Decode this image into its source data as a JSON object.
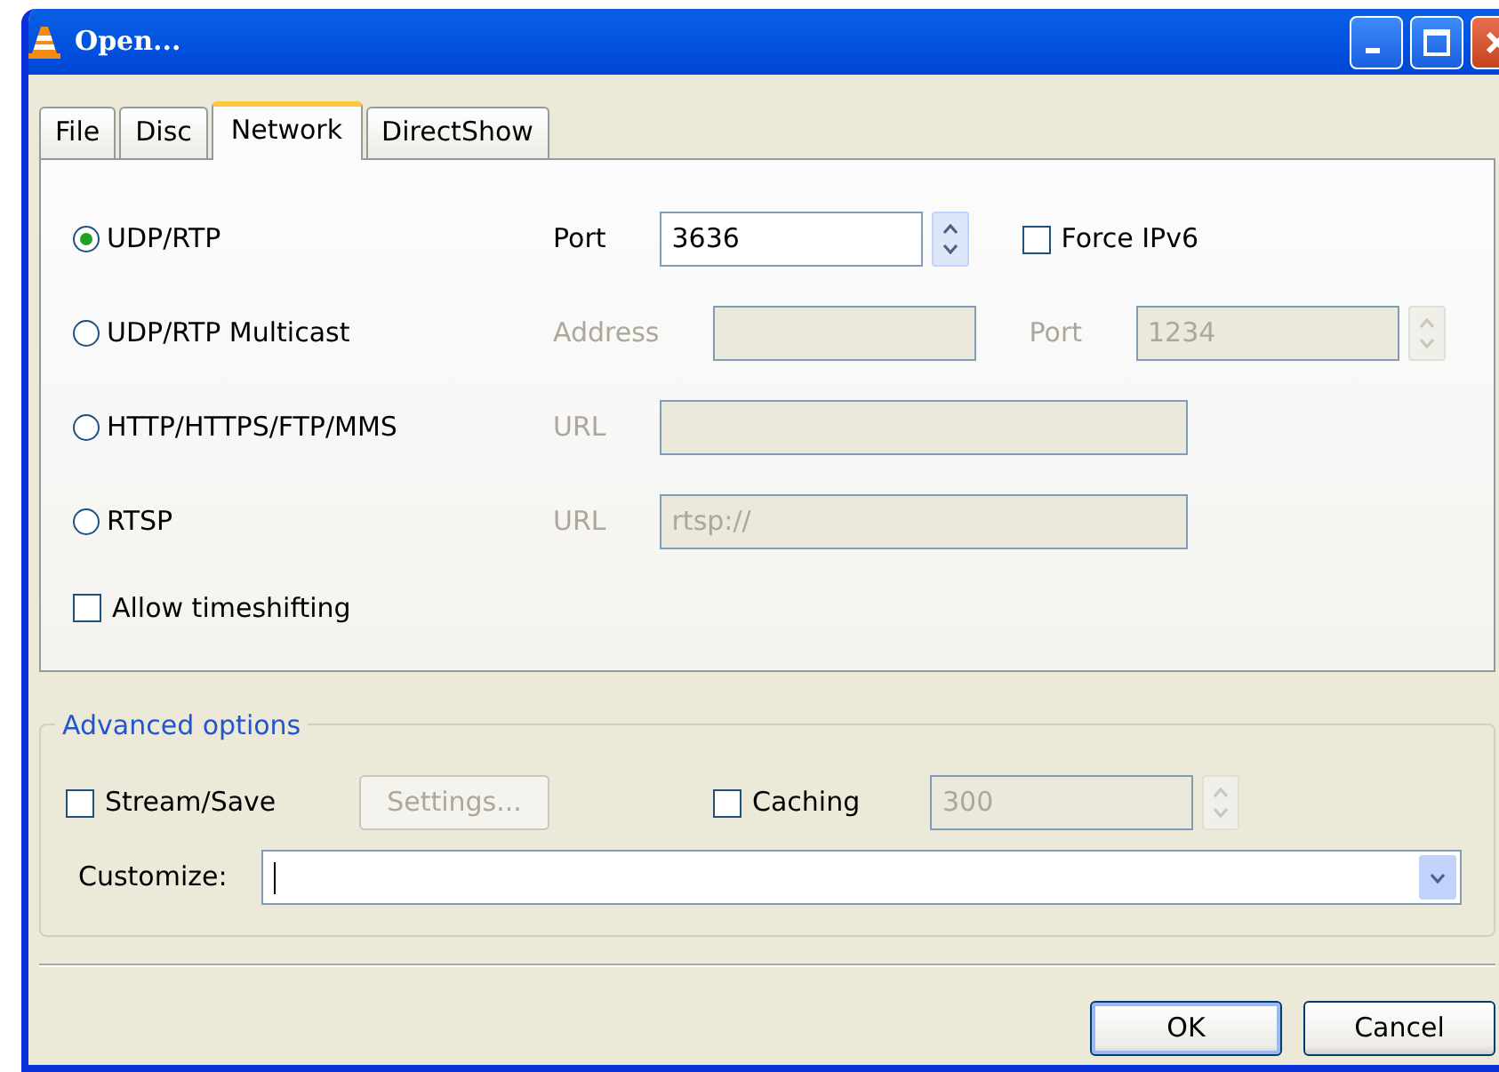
{
  "window": {
    "title": "Open..."
  },
  "tabs": [
    {
      "label": "File",
      "selected": false
    },
    {
      "label": "Disc",
      "selected": false
    },
    {
      "label": "Network",
      "selected": true
    },
    {
      "label": "DirectShow",
      "selected": false
    }
  ],
  "protocols": [
    {
      "label": "UDP/RTP",
      "selected": true,
      "fields": [
        {
          "kind": "spin",
          "label": "Port",
          "value": "3636",
          "disabled": false
        },
        {
          "kind": "check",
          "label": "Force IPv6",
          "checked": false
        }
      ]
    },
    {
      "label": "UDP/RTP Multicast",
      "selected": false,
      "fields": [
        {
          "kind": "text",
          "label": "Address",
          "disabled": true
        },
        {
          "kind": "spin",
          "label": "Port",
          "value": "1234",
          "disabled": true
        }
      ]
    },
    {
      "label": "HTTP/HTTPS/FTP/MMS",
      "selected": false,
      "fields": [
        {
          "kind": "wide",
          "label": "URL",
          "disabled": true
        }
      ]
    },
    {
      "label": "RTSP",
      "selected": false,
      "fields": [
        {
          "kind": "wide",
          "label": "URL",
          "value": "rtsp://",
          "disabled": true
        }
      ]
    }
  ],
  "timeshift": {
    "label": "Allow timeshifting",
    "checked": false
  },
  "advanced": {
    "title": "Advanced options",
    "stream": {
      "label": "Stream/Save",
      "checked": false
    },
    "settings_button": {
      "label": "Settings...",
      "disabled": true
    },
    "caching": {
      "label": "Caching",
      "checked": false
    },
    "caching_value": {
      "value": "300",
      "disabled": true
    },
    "customize": {
      "label": "Customize:"
    }
  },
  "buttons": [
    {
      "label": "OK",
      "default": true
    },
    {
      "label": "Cancel",
      "default": false
    }
  ]
}
